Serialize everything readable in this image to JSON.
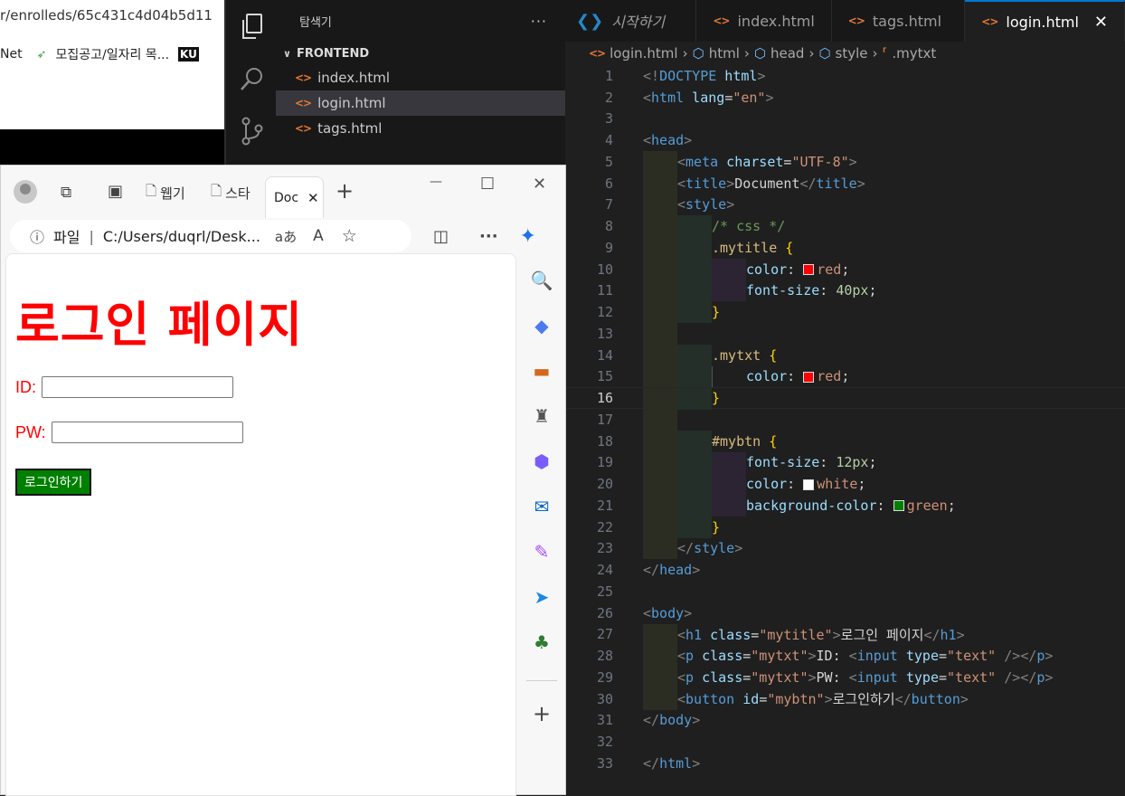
{
  "bg_browser": {
    "url_fragment": "r/enrolleds/65c431c4d04b5d11",
    "favs": [
      "Net",
      "모집공고/일자리 목...",
      "KU"
    ]
  },
  "explorer": {
    "title": "탐색기",
    "more": "···",
    "section": "FRONTEND",
    "files": [
      "index.html",
      "login.html",
      "tags.html"
    ]
  },
  "tabs": {
    "welcome": "시작하기",
    "index": "index.html",
    "tags": "tags.html",
    "login": "login.html",
    "close": "✕"
  },
  "breadcrumb": [
    "login.html",
    "html",
    "head",
    "style",
    ".mytxt"
  ],
  "code": {
    "line_numbers": [
      "1",
      "2",
      "3",
      "4",
      "5",
      "6",
      "7",
      "8",
      "9",
      "10",
      "11",
      "12",
      "13",
      "14",
      "15",
      "16",
      "17",
      "18",
      "19",
      "20",
      "21",
      "22",
      "23",
      "24",
      "25",
      "26",
      "27",
      "28",
      "29",
      "30",
      "31",
      "32",
      "33"
    ],
    "current_line": 16,
    "l1": [
      "<!",
      "DOCTYPE",
      " html",
      ">"
    ],
    "l2": [
      "<",
      "html",
      " lang",
      "=",
      "\"en\"",
      ">"
    ],
    "l4": [
      "<",
      "head",
      ">"
    ],
    "l5": [
      "<",
      "meta",
      " charset",
      "=",
      "\"UTF-8\"",
      ">"
    ],
    "l6": [
      "<",
      "title",
      ">",
      "Document",
      "</",
      "title",
      ">"
    ],
    "l7": [
      "<",
      "style",
      ">"
    ],
    "l8": "/* css */",
    "l9": [
      ".mytitle",
      " {"
    ],
    "l10": [
      "color",
      ": ",
      "red",
      ";"
    ],
    "l11": [
      "font-size",
      ": ",
      "40px",
      ";"
    ],
    "l12": "}",
    "l14": [
      ".mytxt",
      " {"
    ],
    "l15": [
      "color",
      ": ",
      "red",
      ";"
    ],
    "l16": "}",
    "l18": [
      "#mybtn",
      " {"
    ],
    "l19": [
      "font-size",
      ": ",
      "12px",
      ";"
    ],
    "l20": [
      "color",
      ": ",
      "white",
      ";"
    ],
    "l21": [
      "background-color",
      ": ",
      "green",
      ";"
    ],
    "l22": "}",
    "l23": [
      "</",
      "style",
      ">"
    ],
    "l24": [
      "</",
      "head",
      ">"
    ],
    "l26": [
      "<",
      "body",
      ">"
    ],
    "l27": [
      "<",
      "h1",
      " class",
      "=",
      "\"mytitle\"",
      ">",
      "로그인 페이지",
      "</",
      "h1",
      ">"
    ],
    "l28": [
      "<",
      "p",
      " class",
      "=",
      "\"mytxt\"",
      ">",
      "ID: ",
      "<",
      "input",
      " type",
      "=",
      "\"text\"",
      " />",
      "</",
      "p",
      ">"
    ],
    "l29": [
      "<",
      "p",
      " class",
      "=",
      "\"mytxt\"",
      ">",
      "PW: ",
      "<",
      "input",
      " type",
      "=",
      "\"text\"",
      " />",
      "</",
      "p",
      ">"
    ],
    "l30": [
      "<",
      "button",
      " id",
      "=",
      "\"mybtn\"",
      ">",
      "로그인하기",
      "</",
      "button",
      ">"
    ],
    "l31": [
      "</",
      "body",
      ">"
    ],
    "l33": [
      "</",
      "html",
      ">"
    ],
    "swatch_red": "#ff0000",
    "swatch_white": "#ffffff",
    "swatch_green": "#008000"
  },
  "edge": {
    "tab1": "웹기",
    "tab2": "스타",
    "active_tab": "Doc",
    "tab_close": "✕",
    "new_tab": "+",
    "minimize": "—",
    "maximize": "☐",
    "close": "✕",
    "info_label": "파일",
    "address": "C:/Users/duqrl/Desk...",
    "aa": "aあ",
    "read_aloud": "A",
    "more": "···"
  },
  "page": {
    "title": "로그인 페이지",
    "id_label": "ID:",
    "pw_label": "PW:",
    "button_label": "로그인하기",
    "title_color": "#ff0000",
    "button_bg": "#008000"
  }
}
